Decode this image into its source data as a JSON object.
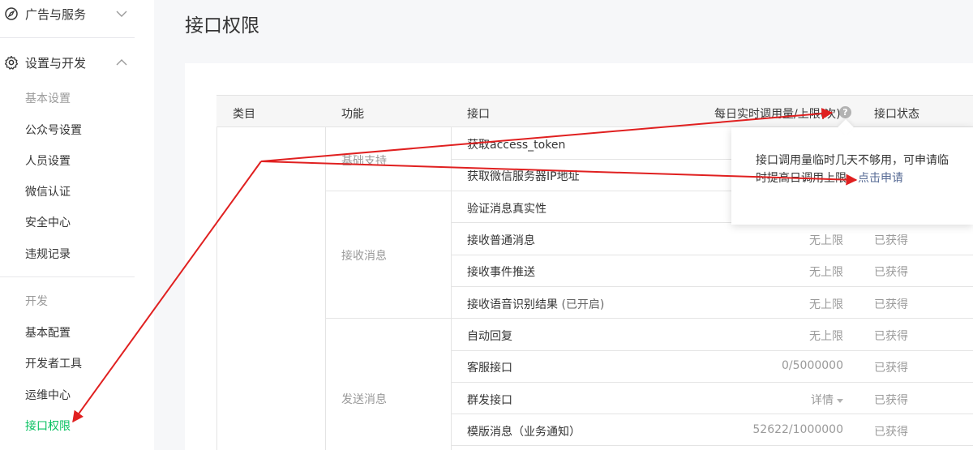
{
  "sidebar": {
    "group_ads": {
      "label": "广告与服务",
      "icon": "compass-icon",
      "expanded": false
    },
    "group_settings": {
      "label": "设置与开发",
      "icon": "gear-icon",
      "expanded": true
    },
    "section_basic": "基本设置",
    "basic_items": [
      "公众号设置",
      "人员设置",
      "微信认证",
      "安全中心",
      "违规记录"
    ],
    "section_dev": "开发",
    "dev_items": [
      "基本配置",
      "开发者工具",
      "运维中心",
      "接口权限"
    ],
    "active_item": "接口权限"
  },
  "page": {
    "title": "接口权限"
  },
  "table": {
    "headers": {
      "category": "类目",
      "function": "功能",
      "api": "接口",
      "quota": "每日实时调用量/上限(次)",
      "status": "接口状态"
    },
    "groups": [
      {
        "function": "基础支持"
      },
      {
        "function": "接收消息"
      },
      {
        "function": "发送消息"
      }
    ],
    "rows": [
      {
        "api": "获取access_token",
        "note": "",
        "quota": "",
        "status": ""
      },
      {
        "api": "获取微信服务器IP地址",
        "note": "",
        "quota": "",
        "status": ""
      },
      {
        "api": "验证消息真实性",
        "note": "",
        "quota": "",
        "status": ""
      },
      {
        "api": "接收普通消息",
        "note": "",
        "quota": "无上限",
        "status": "已获得"
      },
      {
        "api": "接收事件推送",
        "note": "",
        "quota": "无上限",
        "status": "已获得"
      },
      {
        "api": "接收语音识别结果",
        "note": "(已开启)",
        "quota": "无上限",
        "status": "已获得"
      },
      {
        "api": "自动回复",
        "note": "",
        "quota": "无上限",
        "status": "已获得"
      },
      {
        "api": "客服接口",
        "note": "",
        "quota": "0/5000000",
        "status": "已获得"
      },
      {
        "api": "群发接口",
        "note": "",
        "quota": "详情",
        "status": "已获得"
      },
      {
        "api": "模版消息（业务通知）",
        "note": "",
        "quota": "52622/1000000",
        "status": "已获得"
      }
    ]
  },
  "tooltip": {
    "text": "接口调用量临时几天不够用，可申请临时提高日调用上限，",
    "link": "点击申请"
  },
  "colors": {
    "accent_green": "#07c160",
    "link_blue": "#576b95",
    "annotation_red": "#e02020",
    "muted_text": "#9a9a9a"
  }
}
